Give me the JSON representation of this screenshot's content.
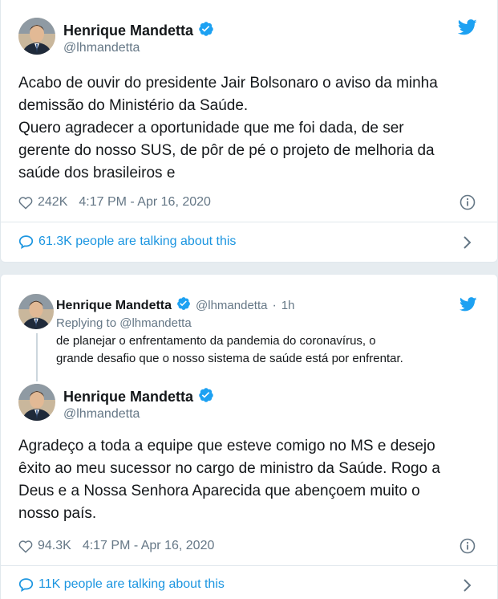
{
  "tweet1": {
    "author_name": "Henrique Mandetta",
    "author_handle": "@lhmandetta",
    "text_lines": [
      "Acabo de ouvir do presidente Jair Bolsonaro o aviso da minha",
      "demissão do Ministério da Saúde.",
      "Quero agradecer a oportunidade que me foi dada, de ser",
      "gerente do nosso SUS, de pôr de pé o projeto de melhoria da",
      "saúde dos brasileiros e"
    ],
    "likes": "242K",
    "timestamp": "4:17 PM - Apr 16, 2020",
    "talking": "61.3K people are talking about this"
  },
  "tweet2": {
    "parent": {
      "author_name": "Henrique Mandetta",
      "author_handle": "@lhmandetta",
      "dot": "·",
      "time": "1h",
      "replying_to_label": "Replying to",
      "replying_to_handle": "@lhmandetta",
      "text_lines": [
        "de planejar o enfrentamento da pandemia do coronavírus, o",
        "grande desafio que o nosso sistema de saúde está por enfrentar."
      ]
    },
    "author_name": "Henrique Mandetta",
    "author_handle": "@lhmandetta",
    "text_lines": [
      "Agradeço a toda a equipe que esteve comigo no MS e desejo",
      "êxito ao meu sucessor no cargo de ministro da Saúde. Rogo a",
      "Deus e a Nossa Senhora Aparecida que abençoem muito o",
      "nosso país."
    ],
    "likes": "94.3K",
    "timestamp": "4:17 PM - Apr 16, 2020",
    "talking": "11K people are talking about this"
  },
  "icons": {
    "verified": "verified-badge-icon",
    "twitter": "twitter-bird-icon",
    "heart": "heart-icon",
    "info": "info-icon",
    "bubble": "speech-bubble-icon",
    "chevron": "chevron-right-icon"
  },
  "colors": {
    "accent": "#1da1f2",
    "link": "#1b95e0",
    "muted": "#657786",
    "text": "#14171a"
  }
}
